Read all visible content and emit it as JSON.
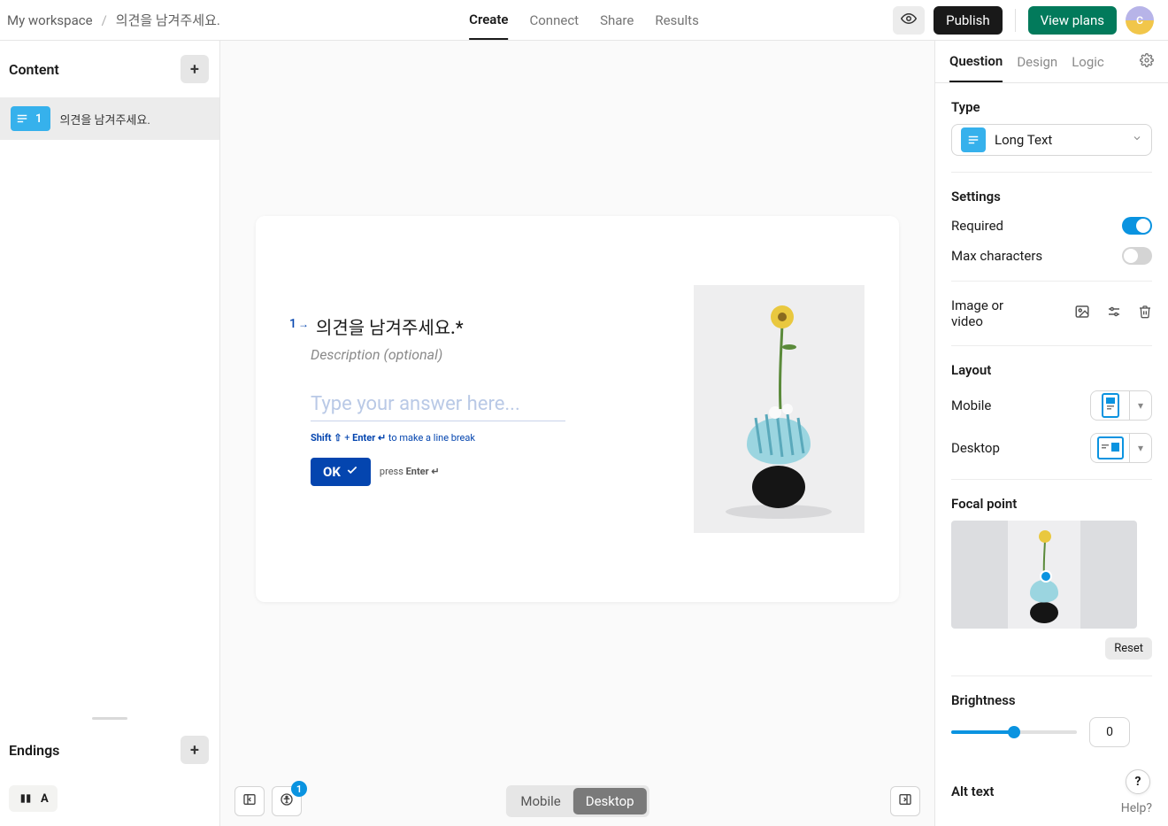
{
  "header": {
    "workspace": "My workspace",
    "sep": "/",
    "formTitle": "의견을 남겨주세요.",
    "tabs": {
      "create": "Create",
      "connect": "Connect",
      "share": "Share",
      "results": "Results"
    },
    "publish": "Publish",
    "viewPlans": "View plans",
    "avatarLetter": "C"
  },
  "sidebar": {
    "contentHeader": "Content",
    "items": [
      {
        "number": "1",
        "text": "의견을 남겨주세요."
      }
    ],
    "endingsHeader": "Endings",
    "endingLetter": "A"
  },
  "canvas": {
    "questionNumber": "1",
    "questionArrow": "→",
    "questionTitle": "의견을 남겨주세요.*",
    "description": "Description (optional)",
    "placeholder": "Type your answer here...",
    "hint": {
      "shift": "Shift ⇧",
      "plus": " + ",
      "enter": "Enter ↵",
      "rest": " to make a line break"
    },
    "ok": "OK",
    "press": {
      "a": "press ",
      "b": "Enter ↵"
    },
    "device": {
      "mobile": "Mobile",
      "desktop": "Desktop"
    },
    "accBadge": "1"
  },
  "right": {
    "tabs": {
      "question": "Question",
      "design": "Design",
      "logic": "Logic"
    },
    "typeLabel": "Type",
    "typeValue": "Long Text",
    "settingsLabel": "Settings",
    "required": "Required",
    "maxChars": "Max characters",
    "imageVideo": "Image or video",
    "layoutLabel": "Layout",
    "mobile": "Mobile",
    "desktop": "Desktop",
    "focalLabel": "Focal point",
    "reset": "Reset",
    "brightnessLabel": "Brightness",
    "brightnessValue": "0",
    "altText": "Alt text",
    "help": "Help?"
  }
}
